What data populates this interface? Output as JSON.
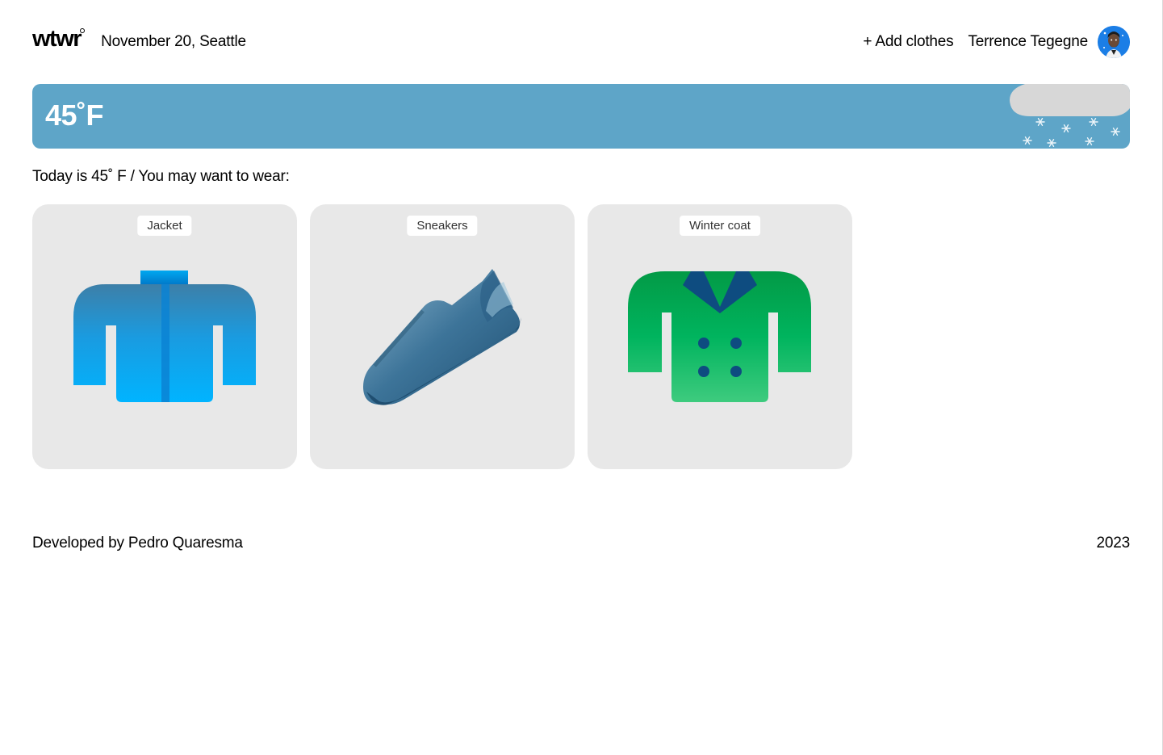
{
  "header": {
    "logo": "wtwr",
    "date_location": "November 20, Seattle",
    "add_clothes": "+ Add clothes",
    "username": "Terrence Tegegne"
  },
  "weather": {
    "temperature": "45˚F",
    "condition_icon": "snow-cloud-icon"
  },
  "recommendation": "Today is 45˚ F / You may want to wear:",
  "items": [
    {
      "name": "Jacket",
      "icon": "jacket-icon"
    },
    {
      "name": "Sneakers",
      "icon": "sneaker-icon"
    },
    {
      "name": "Winter coat",
      "icon": "winter-coat-icon"
    }
  ],
  "footer": {
    "developer": "Developed by Pedro Quaresma",
    "year": "2023"
  },
  "colors": {
    "weather_bar": "#5ea5c8",
    "card_background": "#e8e8e8",
    "jacket": "#00b4ff",
    "sneaker": "#2f6a8f",
    "winter_coat": "#00a651"
  }
}
